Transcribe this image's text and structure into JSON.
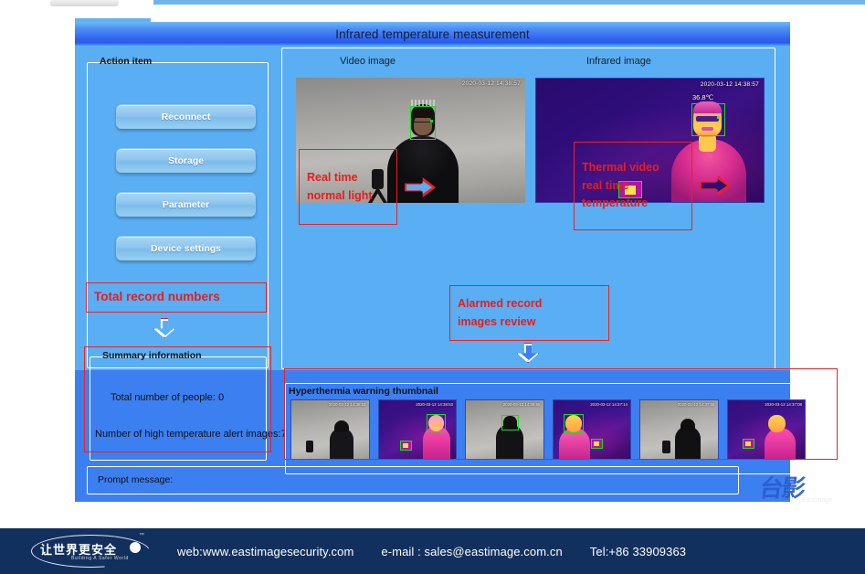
{
  "window": {
    "title": "Infrared temperature measurement"
  },
  "sidebar": {
    "group_title": "Action item",
    "buttons": [
      {
        "label": "Reconnect"
      },
      {
        "label": "Storage"
      },
      {
        "label": "Parameter"
      },
      {
        "label": "Device settings"
      }
    ]
  },
  "summary": {
    "group_title": "Summary information",
    "total_people": "Total number of people:   0",
    "alert_images": "Number of high temperature alert images:7"
  },
  "cameras": {
    "video_label": "Video image",
    "infrared_label": "Infrared image",
    "video_timestamp": "2020-03-12 14:38:57",
    "infrared_timestamp": "2020-03-12 14:38:57",
    "face_temperature": "36.8℃"
  },
  "annotations": {
    "total_records": "Total record numbers",
    "real_time_line1": "Real time",
    "real_time_line2": "normal light",
    "thermal_line1": "Thermal video",
    "thermal_line2": "real time",
    "thermal_line3": "temperature",
    "alarm_line1": "Alarmed record",
    "alarm_line2": "images review"
  },
  "thumbnails": {
    "group_title": "Hyperthermia warning thumbnail",
    "items": [
      {
        "kind": "visible",
        "timestamp": "2020-03-12 14:38:53"
      },
      {
        "kind": "infrared",
        "timestamp": "2020-03-12 14:38:53"
      },
      {
        "kind": "visible",
        "timestamp": "2020-03-12 14:38:55"
      },
      {
        "kind": "infrared",
        "timestamp": "2020-03-12 14:37:14"
      },
      {
        "kind": "visible",
        "timestamp": "2020-03-12 14:37:08"
      },
      {
        "kind": "infrared",
        "timestamp": "2020-03-12 14:37:08"
      }
    ]
  },
  "prompt": {
    "label": "Prompt message:"
  },
  "brand": {
    "watermark_text": "Eastimage"
  },
  "footer": {
    "logo_cn": "让世界更安全",
    "logo_en": "Building A Safer World",
    "logo_tm": "™",
    "web": "web:www.eastimagesecurity.com",
    "email": "e-mail : sales@eastimage.com.cn",
    "tel": "Tel:+86 33909363"
  },
  "colors": {
    "window_bg": "#3c7ff0",
    "upper_bg": "#5aaef3",
    "titlebar": "#2f63ee",
    "annotation_red": "#e81d1d",
    "footer_bg": "#12305e",
    "detection_green": "#16e016"
  }
}
